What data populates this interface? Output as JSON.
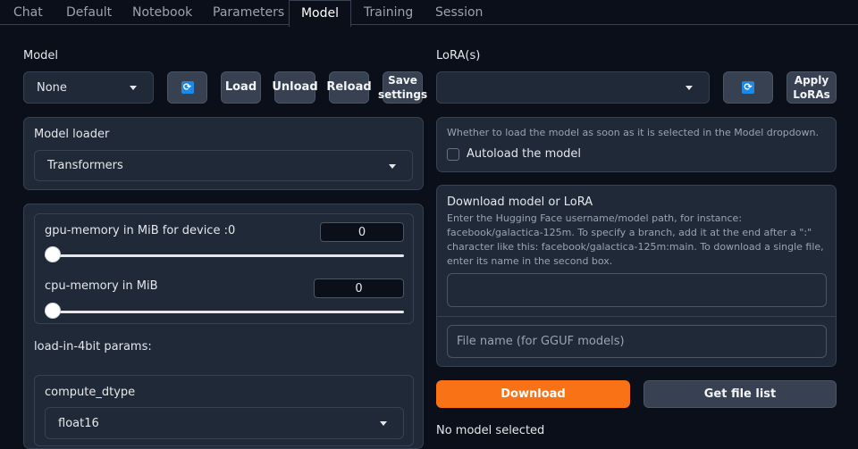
{
  "tabs": [
    "Chat",
    "Default",
    "Notebook",
    "Parameters",
    "Model",
    "Training",
    "Session"
  ],
  "active_tab": "Model",
  "model": {
    "label": "Model",
    "selected": "None",
    "load": "Load",
    "unload": "Unload",
    "reload": "Reload",
    "save_settings": "Save settings"
  },
  "loader": {
    "label": "Model loader",
    "selected": "Transformers"
  },
  "gpu_memory": {
    "label": "gpu-memory in MiB for device :0",
    "value": "0",
    "fraction": 0
  },
  "cpu_memory": {
    "label": "cpu-memory in MiB",
    "value": "0",
    "fraction": 0
  },
  "load_in_4bit": {
    "heading": "load-in-4bit params:",
    "compute_dtype_label": "compute_dtype",
    "compute_dtype_value": "float16"
  },
  "lora": {
    "label": "LoRA(s)",
    "selected": "",
    "apply": "Apply LoRAs"
  },
  "autoload": {
    "info": "Whether to load the model as soon as it is selected in the Model dropdown.",
    "label": "Autoload the model",
    "checked": false
  },
  "download": {
    "title": "Download model or LoRA",
    "info": "Enter the Hugging Face username/model path, for instance: facebook/galactica-125m. To specify a branch, add it at the end after a \":\" character like this: facebook/galactica-125m:main. To download a single file, enter its name in the second box.",
    "path_value": "",
    "file_placeholder": "File name (for GGUF models)",
    "download_button": "Download",
    "get_file_list_button": "Get file list"
  },
  "status": "No model selected",
  "colors": {
    "accent": "#f97316",
    "background": "#0b0f19",
    "panel": "#1f2937",
    "refresh_icon": "#1e88e5"
  }
}
